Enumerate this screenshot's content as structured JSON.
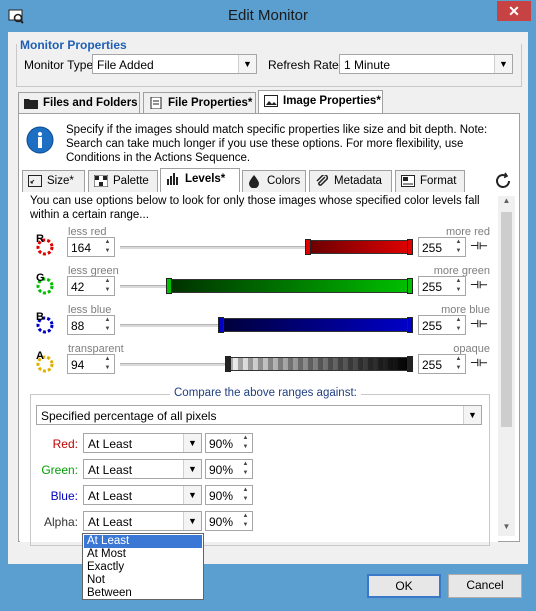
{
  "window": {
    "title": "Edit Monitor",
    "close": "✕"
  },
  "monitor_properties": {
    "title": "Monitor Properties",
    "type_label": "Monitor Type:",
    "type_value": "File Added",
    "refresh_label": "Refresh Rate:",
    "refresh_value": "1 Minute"
  },
  "tabs": [
    {
      "label": "Files and Folders",
      "icon": "folder-icon"
    },
    {
      "label": "File Properties*",
      "icon": "file-icon"
    },
    {
      "label": "Image Properties*",
      "icon": "image-icon"
    }
  ],
  "info_text": "Specify if the images should match specific properties like size and bit depth. Note: Search can take much longer if you use these options. For more flexibility, use Conditions in the Actions Sequence.",
  "subtabs": [
    {
      "label": "Size*",
      "icon": "size-icon"
    },
    {
      "label": "Palette",
      "icon": "palette-icon"
    },
    {
      "label": "Levels*",
      "icon": "levels-icon"
    },
    {
      "label": "Colors",
      "icon": "colors-icon"
    },
    {
      "label": "Metadata",
      "icon": "metadata-icon"
    },
    {
      "label": "Format",
      "icon": "format-icon"
    }
  ],
  "levels_desc": "You can use options below to look for only those images whose specified color levels fall within a certain range...",
  "channels": [
    {
      "letter": "R",
      "less": "less red",
      "more": "more red",
      "min": "164",
      "max": "255",
      "color": "#e00000",
      "lo": 164,
      "hi": 255
    },
    {
      "letter": "G",
      "less": "less green",
      "more": "more green",
      "min": "42",
      "max": "255",
      "color": "#00c000",
      "lo": 42,
      "hi": 255
    },
    {
      "letter": "B",
      "less": "less blue",
      "more": "more blue",
      "min": "88",
      "max": "255",
      "color": "#0000c8",
      "lo": 88,
      "hi": 255
    },
    {
      "letter": "A",
      "less": "transparent",
      "more": "opaque",
      "min": "94",
      "max": "255",
      "color": "#555555",
      "lo": 94,
      "hi": 255
    }
  ],
  "compare": {
    "label": "Compare the above ranges against:",
    "mode": "Specified percentage of all pixels",
    "rows": [
      {
        "label": "Red:",
        "op": "At Least",
        "pct": "90%",
        "color": "#c00000"
      },
      {
        "label": "Green:",
        "op": "At Least",
        "pct": "90%",
        "color": "#00a000"
      },
      {
        "label": "Blue:",
        "op": "At Least",
        "pct": "90%",
        "color": "#0000c0"
      },
      {
        "label": "Alpha:",
        "op": "At Least",
        "pct": "90%",
        "color": "#333333"
      }
    ]
  },
  "dropdown_options": [
    "At Least",
    "At Most",
    "Exactly",
    "Not",
    "Between"
  ],
  "buttons": {
    "ok": "OK",
    "cancel": "Cancel"
  }
}
